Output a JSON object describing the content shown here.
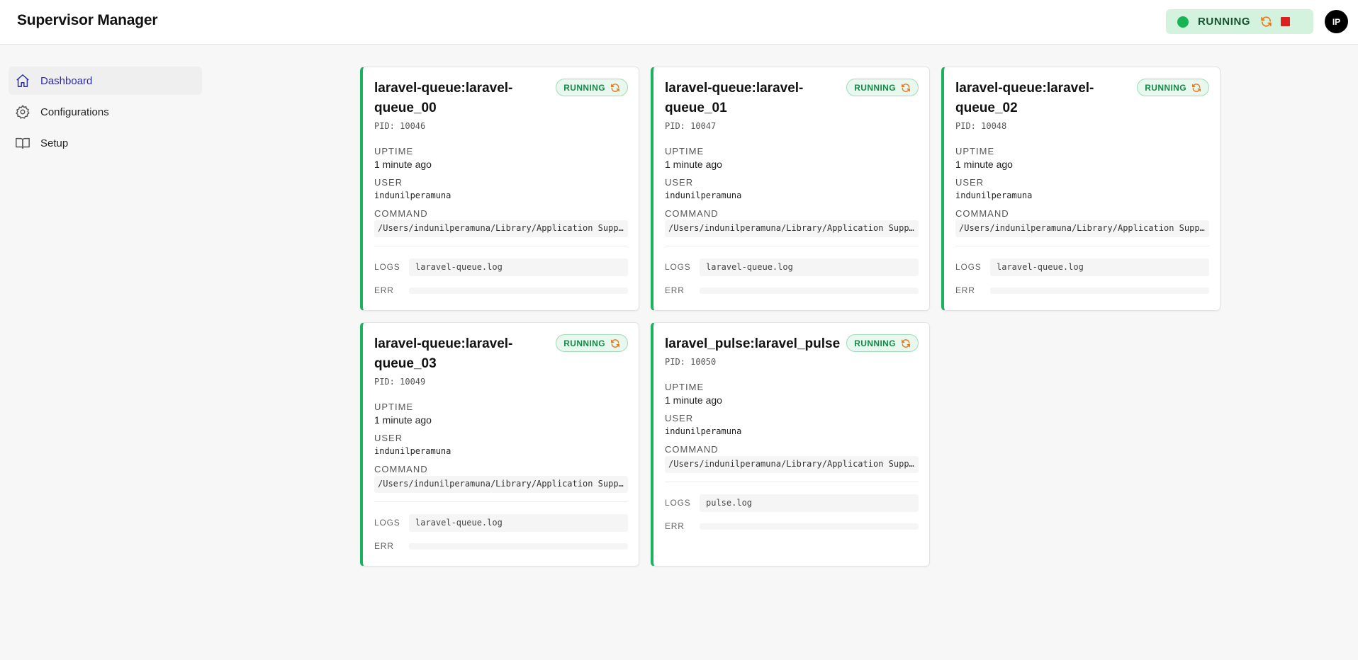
{
  "header": {
    "title": "Supervisor Manager",
    "status": "RUNNING",
    "avatar_initials": "IP"
  },
  "sidebar": {
    "items": [
      {
        "label": "Dashboard",
        "icon": "home-icon",
        "active": true
      },
      {
        "label": "Configurations",
        "icon": "gear-icon",
        "active": false
      },
      {
        "label": "Setup",
        "icon": "book-icon",
        "active": false
      }
    ]
  },
  "labels": {
    "uptime": "UPTIME",
    "user": "USER",
    "command": "COMMAND",
    "logs": "LOGS",
    "err": "ERR",
    "pid_prefix": "PID:"
  },
  "processes": [
    {
      "name": "laravel-queue:laravel-queue_00",
      "status": "RUNNING",
      "pid": "PID: 10046",
      "uptime": "1 minute ago",
      "user": "indunilperamuna",
      "command": "/Users/indunilperamuna/Library/Application Supp…",
      "log": "laravel-queue.log",
      "err": ""
    },
    {
      "name": "laravel-queue:laravel-queue_01",
      "status": "RUNNING",
      "pid": "PID: 10047",
      "uptime": "1 minute ago",
      "user": "indunilperamuna",
      "command": "/Users/indunilperamuna/Library/Application Supp…",
      "log": "laravel-queue.log",
      "err": ""
    },
    {
      "name": "laravel-queue:laravel-queue_02",
      "status": "RUNNING",
      "pid": "PID: 10048",
      "uptime": "1 minute ago",
      "user": "indunilperamuna",
      "command": "/Users/indunilperamuna/Library/Application Supp…",
      "log": "laravel-queue.log",
      "err": ""
    },
    {
      "name": "laravel-queue:laravel-queue_03",
      "status": "RUNNING",
      "pid": "PID: 10049",
      "uptime": "1 minute ago",
      "user": "indunilperamuna",
      "command": "/Users/indunilperamuna/Library/Application Supp…",
      "log": "laravel-queue.log",
      "err": ""
    },
    {
      "name": "laravel_pulse:laravel_pulse",
      "status": "RUNNING",
      "pid": "PID: 10050",
      "uptime": "1 minute ago",
      "user": "indunilperamuna",
      "command": "/Users/indunilperamuna/Library/Application Supp…",
      "log": "pulse.log",
      "err": ""
    }
  ],
  "colors": {
    "accent": "#19b25d",
    "running_text": "#138a46",
    "stop": "#dc1f1f",
    "restart": "#e8761a",
    "nav_active": "#2c2ba8"
  }
}
